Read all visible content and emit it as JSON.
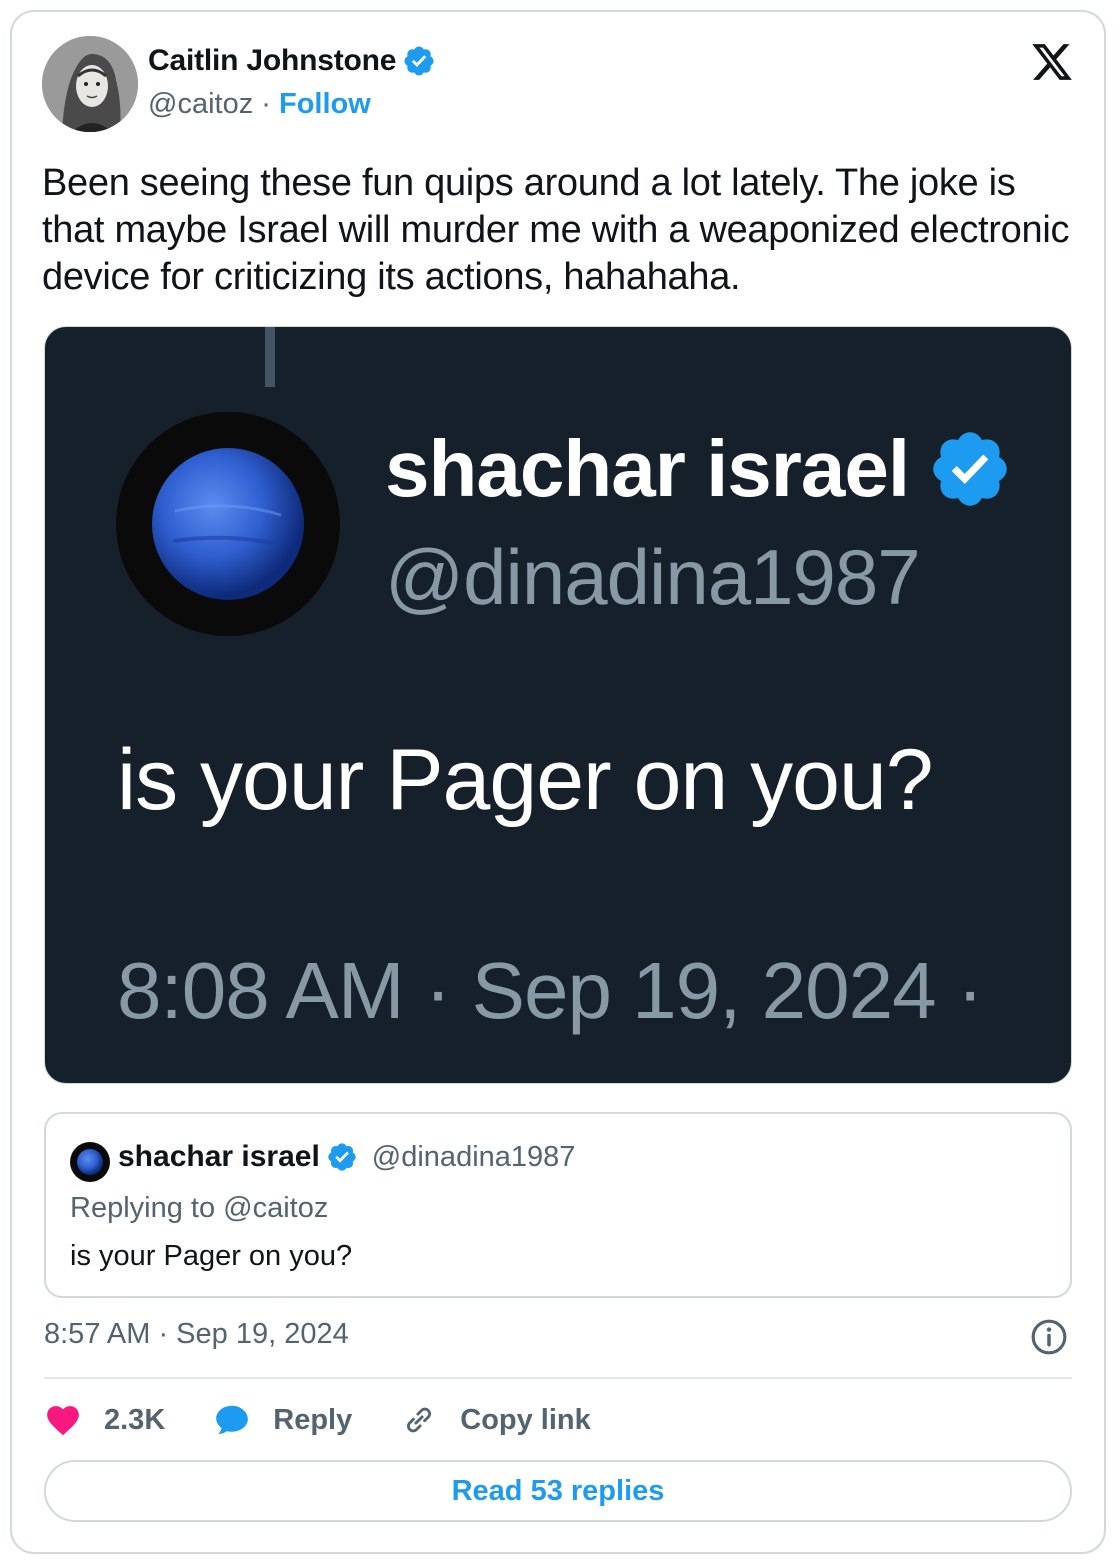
{
  "author": {
    "name": "Caitlin Johnstone",
    "handle": "@caitoz",
    "separator": "·",
    "follow_label": "Follow"
  },
  "tweet": {
    "text": "Been seeing these fun quips around a lot lately. The joke is that maybe Israel will murder me with a weaponized electronic device for criticizing its actions, hahahaha.",
    "timestamp": "8:57 AM · Sep 19, 2024"
  },
  "media_screenshot": {
    "name": "shachar israel",
    "handle": "@dinadina1987",
    "text": "is your Pager on you?",
    "timestamp": "8:08 AM · Sep 19, 2024 ·"
  },
  "quoted_tweet": {
    "name": "shachar israel",
    "handle": "@dinadina1987",
    "replying_to": "Replying to @caitoz",
    "text": "is your Pager on you?"
  },
  "actions": {
    "likes": "2.3K",
    "reply_label": "Reply",
    "copy_link_label": "Copy link"
  },
  "read_replies_label": "Read 53 replies",
  "colors": {
    "accent": "#1d9bf0",
    "like": "#f91880",
    "media_bg": "#15202b",
    "muted": "#536471"
  }
}
